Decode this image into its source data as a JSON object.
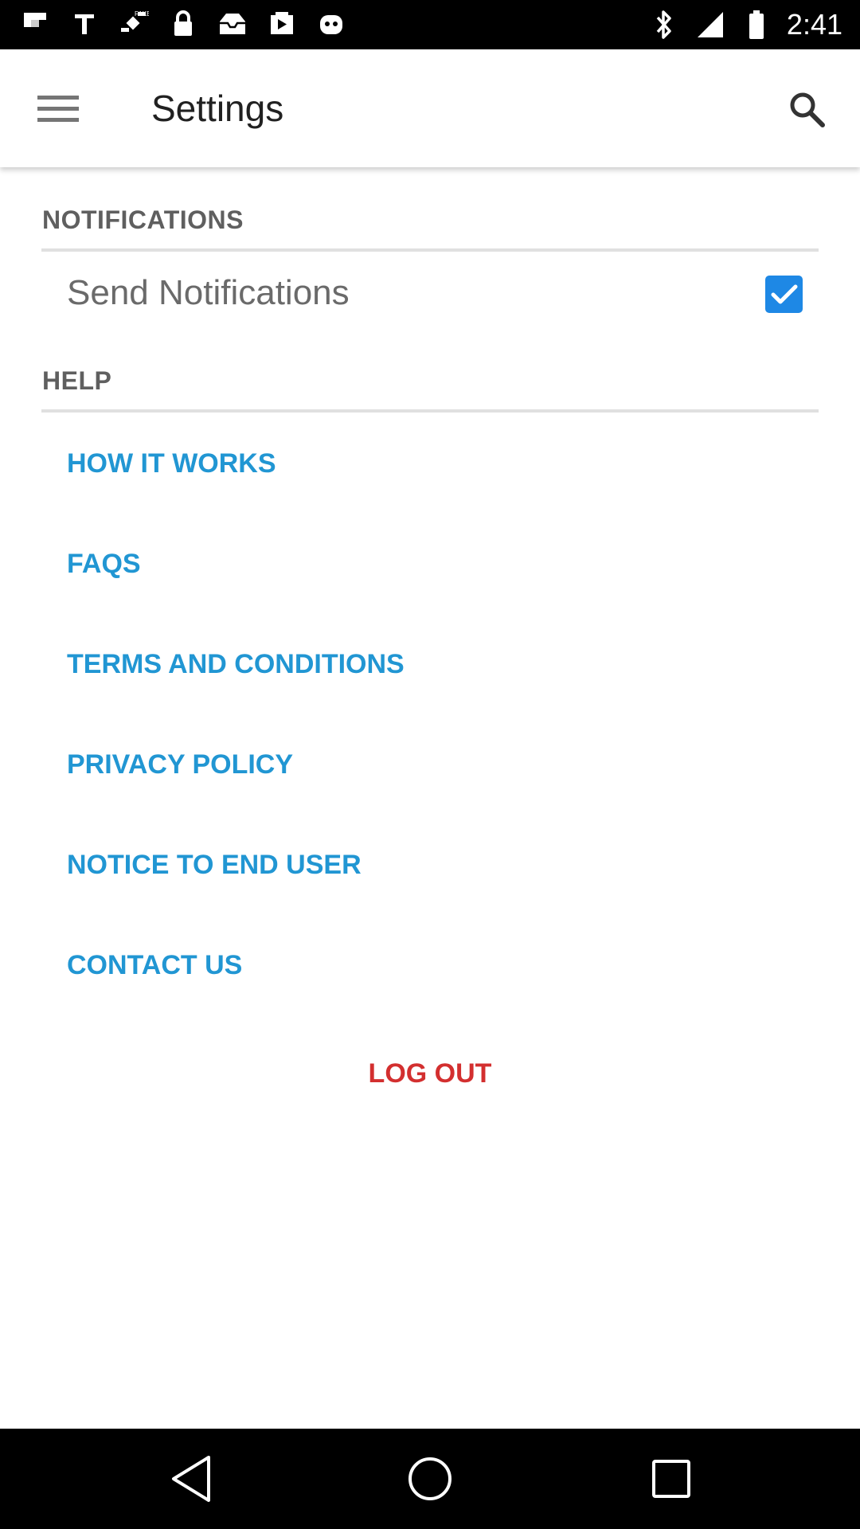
{
  "status_bar": {
    "time": "2:41",
    "left_icons": [
      "flipboard-icon",
      "text-icon",
      "fake-gps-icon",
      "lock-icon",
      "inbox-icon",
      "play-store-icon",
      "robot-icon"
    ],
    "right_icons": [
      "bluetooth-icon",
      "signal-icon",
      "battery-icon"
    ]
  },
  "app_bar": {
    "title": "Settings",
    "menu_icon": "hamburger-menu-icon",
    "search_icon": "search-icon"
  },
  "notifications_section": {
    "header": "NOTIFICATIONS",
    "send_notifications": {
      "label": "Send Notifications",
      "checked": true
    }
  },
  "help_section": {
    "header": "HELP",
    "links": [
      "HOW IT WORKS",
      "FAQS",
      "TERMS AND CONDITIONS",
      "PRIVACY POLICY",
      "NOTICE TO END USER",
      "CONTACT US"
    ]
  },
  "logout_label": "LOG OUT",
  "colors": {
    "link": "#2196d3",
    "logout": "#d32f2f",
    "checkbox": "#1e88e5",
    "section_header": "#5f5f5f",
    "status_bar": "#000000",
    "nav_bar": "#000000"
  },
  "nav_bar": {
    "buttons": [
      "back-icon",
      "home-icon",
      "recents-icon"
    ]
  }
}
